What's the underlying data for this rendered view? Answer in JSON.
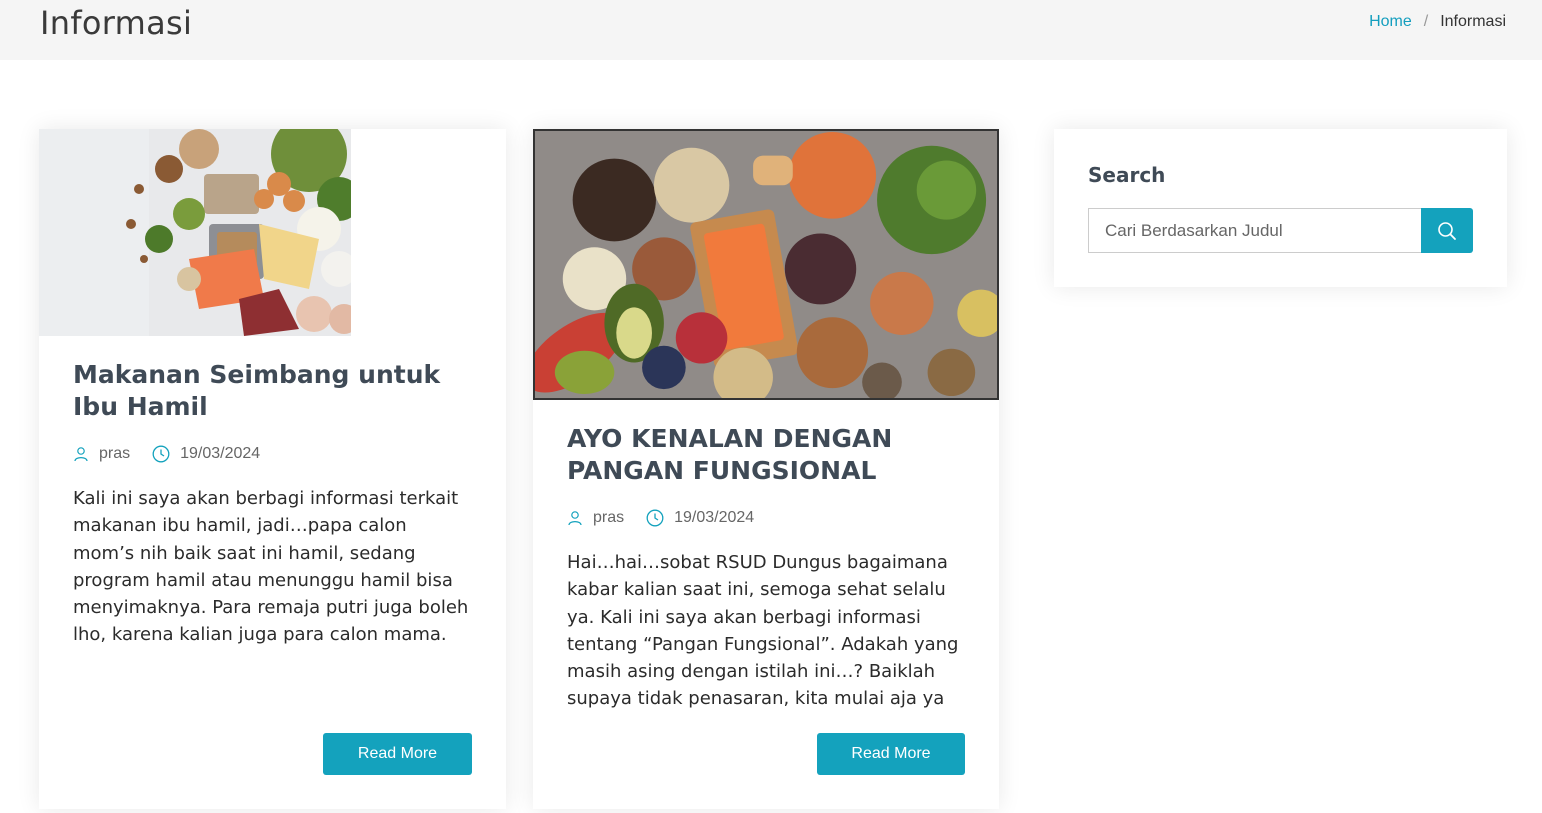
{
  "header": {
    "title": "Informasi",
    "breadcrumb": {
      "home_label": "Home",
      "separator": "/",
      "current_label": "Informasi"
    }
  },
  "posts": [
    {
      "title": "Makanan Seimbang untuk Ibu Hamil",
      "author": "pras",
      "date": "19/03/2024",
      "excerpt": "Kali ini saya akan berbagi informasi terkait makanan ibu hamil, jadi…papa calon mom’s nih baik saat ini hamil, sedang program hamil atau menunggu hamil bisa menyimaknya. Para remaja putri juga boleh lho, karena kalian juga para calon mama.",
      "button_label": "Read More",
      "image": "balanced-food-photo"
    },
    {
      "title": "AYO KENALAN DENGAN PANGAN FUNGSIONAL",
      "author": "pras",
      "date": "19/03/2024",
      "excerpt": "Hai…hai…sobat RSUD Dungus bagaimana kabar kalian saat ini, semoga sehat selalu ya. Kali ini saya akan berbagi informasi tentang “Pangan Fungsional”. Adakah yang masih asing dengan istilah ini…? Baiklah supaya tidak penasaran, kita mulai aja ya",
      "button_label": "Read More",
      "image": "functional-food-photo"
    }
  ],
  "sidebar": {
    "search_title": "Search",
    "search_placeholder": "Cari Berdasarkan Judul",
    "search_icon": "search-icon"
  },
  "colors": {
    "accent": "#14a2bd",
    "header_bg": "#f5f5f5",
    "title_text": "#3f4a56"
  }
}
